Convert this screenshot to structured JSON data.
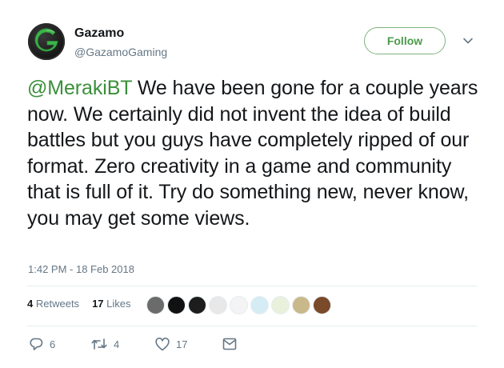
{
  "account": {
    "display_name": "Gazamo",
    "handle": "@GazamoGaming",
    "avatar_icon": "gazamo-logo-g",
    "brand_color": "#3bb54a"
  },
  "follow_label": "Follow",
  "tweet": {
    "mention": "@MerakiBT",
    "text": " We have been gone for a couple years now. We certainly did not invent the idea of build battles but you guys have completely ripped of our format. Zero creativity in a game and community that is full of it. Try do something new, never know, you may get some views.",
    "timestamp": "1:42 PM - 18 Feb 2018"
  },
  "stats": {
    "retweets_count": "4",
    "retweets_label": "Retweets",
    "likes_count": "17",
    "likes_label": "Likes"
  },
  "likers": [
    {
      "name": "liker-1",
      "color": "#6b6b6b"
    },
    {
      "name": "liker-2",
      "color": "#111111"
    },
    {
      "name": "liker-3",
      "color": "#1d1d1d"
    },
    {
      "name": "liker-4",
      "color": "#e8e8e8"
    },
    {
      "name": "liker-5",
      "color": "#f4f4f4"
    },
    {
      "name": "liker-6",
      "color": "#d6ecf5"
    },
    {
      "name": "liker-7",
      "color": "#e9f1dc"
    },
    {
      "name": "liker-8",
      "color": "#c9b98a"
    },
    {
      "name": "liker-9",
      "color": "#7a4a2a"
    }
  ],
  "actions": {
    "reply_count": "6",
    "retweet_count": "4",
    "like_count": "17",
    "icons": [
      "reply-icon",
      "retweet-icon",
      "heart-icon",
      "envelope-icon"
    ]
  },
  "colors": {
    "text": "#14171a",
    "secondary": "#657786",
    "accent": "#3a8f3a",
    "divider": "#e6ecf0"
  }
}
